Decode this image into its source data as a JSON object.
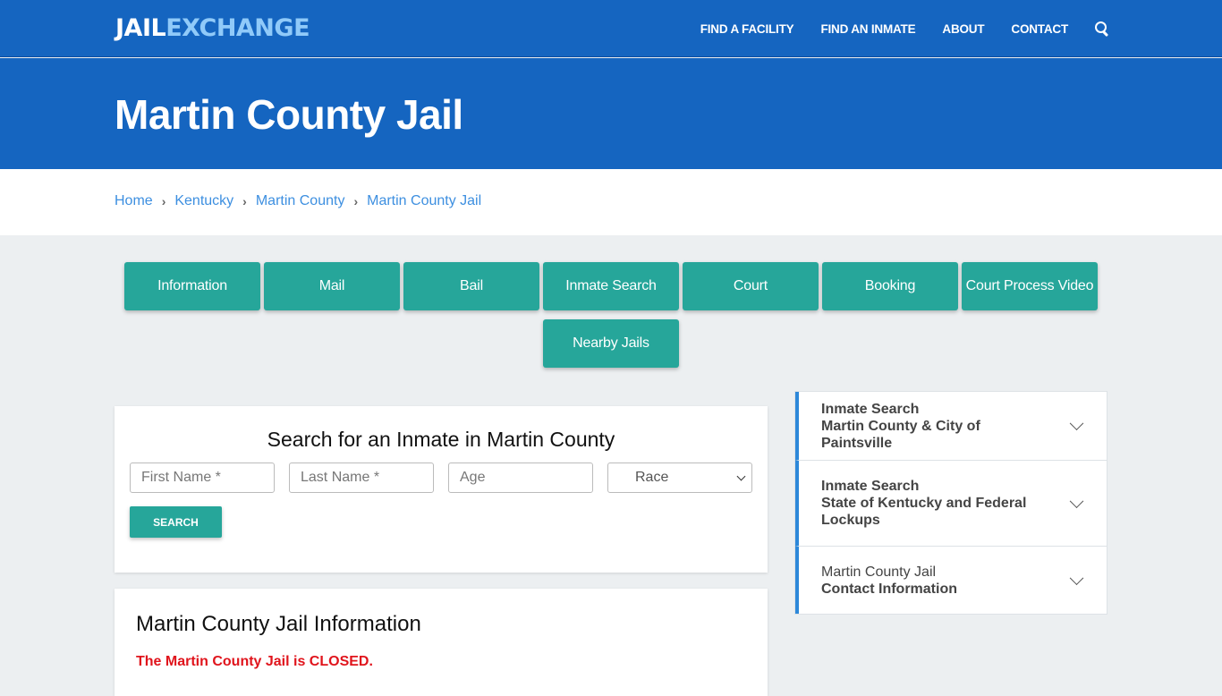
{
  "header": {
    "logo": {
      "part1": "JAIL",
      "part2": "EXCHANGE"
    },
    "nav": [
      {
        "label": "FIND A FACILITY"
      },
      {
        "label": "FIND AN INMATE"
      },
      {
        "label": "ABOUT"
      },
      {
        "label": "CONTACT"
      }
    ],
    "search_icon": "search-icon"
  },
  "hero": {
    "title": "Martin County Jail"
  },
  "breadcrumb": [
    {
      "label": "Home"
    },
    {
      "label": "Kentucky"
    },
    {
      "label": "Martin County"
    },
    {
      "label": "Martin County Jail"
    }
  ],
  "tabs": [
    {
      "label": "Information"
    },
    {
      "label": "Mail"
    },
    {
      "label": "Bail"
    },
    {
      "label": "Inmate Search"
    },
    {
      "label": "Court"
    },
    {
      "label": "Booking"
    },
    {
      "label": "Court Process Video"
    },
    {
      "label": "Nearby Jails"
    }
  ],
  "search_form": {
    "title": "Search for an Inmate in Martin County",
    "first_name_placeholder": "First Name *",
    "last_name_placeholder": "Last Name *",
    "age_placeholder": "Age",
    "race_selected": "Race",
    "button_label": "SEARCH"
  },
  "info": {
    "title": "Martin County Jail Information",
    "status": "The Martin County Jail is CLOSED.",
    "status_color": "#e0141c"
  },
  "accordion": [
    {
      "line1": "Inmate Search",
      "line2": "Martin County & City of Paintsville",
      "line1_bold": true
    },
    {
      "line1": "Inmate Search",
      "line2": "State of Kentucky and Federal Lockups",
      "line1_bold": true
    },
    {
      "line1": "Martin County Jail",
      "line2": "Contact Information",
      "line1_bold": false
    }
  ],
  "colors": {
    "brand_blue": "#1565c0",
    "logo_accent": "#90caf9",
    "teal_button": "#26a69a",
    "link_blue": "#3d8fe0",
    "accordion_accent": "#2d88d9"
  }
}
